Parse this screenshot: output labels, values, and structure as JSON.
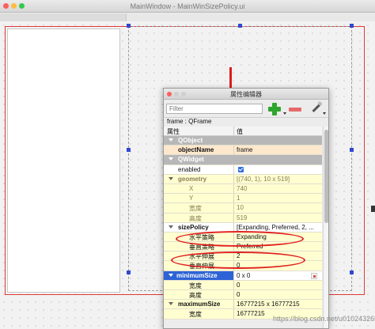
{
  "main_window": {
    "title": "MainWindow - MainWinSizePolicy.ui"
  },
  "toolbar": {
    "filter_placeholder": "Filter",
    "add_icon": "plus-icon",
    "remove_icon": "minus-icon",
    "configure_icon": "wrench-icon"
  },
  "property_editor": {
    "title": "属性编辑器",
    "object_line": "frame : QFrame",
    "column_property": "属性",
    "column_value": "值",
    "rows": [
      {
        "name": "QObject",
        "value": "",
        "style": "group",
        "indent": 18,
        "expanded": true
      },
      {
        "name": "objectName",
        "value": "frame",
        "style": "peach",
        "indent": 18,
        "bold": true
      },
      {
        "name": "QWidget",
        "value": "",
        "style": "group",
        "indent": 18,
        "expanded": true
      },
      {
        "name": "enabled",
        "value": "",
        "style": "white",
        "indent": 18,
        "checkbox": true
      },
      {
        "name": "geometry",
        "value": "[(740, 1), 10 x 519]",
        "style": "yellow",
        "indent": 18,
        "expanded": true,
        "bold": true,
        "dim": true
      },
      {
        "name": "X",
        "value": "740",
        "style": "yellow",
        "indent": 32,
        "dim": true
      },
      {
        "name": "Y",
        "value": "1",
        "style": "yellow",
        "indent": 32,
        "dim": true
      },
      {
        "name": "宽度",
        "value": "10",
        "style": "yellow",
        "indent": 32,
        "dim": true
      },
      {
        "name": "高度",
        "value": "519",
        "style": "yellow",
        "indent": 32,
        "dim": true
      },
      {
        "name": "sizePolicy",
        "value": "[Expanding, Preferred, 2, ...",
        "style": "white",
        "indent": 18,
        "expanded": true,
        "bold": true
      },
      {
        "name": "水平策略",
        "value": "Expanding",
        "style": "yellow",
        "indent": 32
      },
      {
        "name": "垂直策略",
        "value": "Preferred",
        "style": "yellow",
        "indent": 32
      },
      {
        "name": "水平伸展",
        "value": "2",
        "style": "yellow",
        "indent": 32
      },
      {
        "name": "垂直伸展",
        "value": "0",
        "style": "yellow",
        "indent": 32
      },
      {
        "name": "minimumSize",
        "value": "0 x 0",
        "style": "sel",
        "indent": 18,
        "expanded": true,
        "bold": true,
        "reset": true
      },
      {
        "name": "宽度",
        "value": "0",
        "style": "yellow",
        "indent": 32
      },
      {
        "name": "高度",
        "value": "0",
        "style": "yellow",
        "indent": 32
      },
      {
        "name": "maximumSize",
        "value": "16777215 x 16777215",
        "style": "yellow",
        "indent": 18,
        "expanded": true,
        "bold": true
      },
      {
        "name": "宽度",
        "value": "16777215",
        "style": "yellow",
        "indent": 32
      }
    ]
  },
  "colors": {
    "selection_blue": "#2d63d6",
    "annotation_red": "#e02020",
    "group_gray": "#b7b7b7",
    "row_yellow": "#fefed0",
    "row_peach": "#fde8cd"
  },
  "watermark": "https://blog.csdn.net/u010243265"
}
